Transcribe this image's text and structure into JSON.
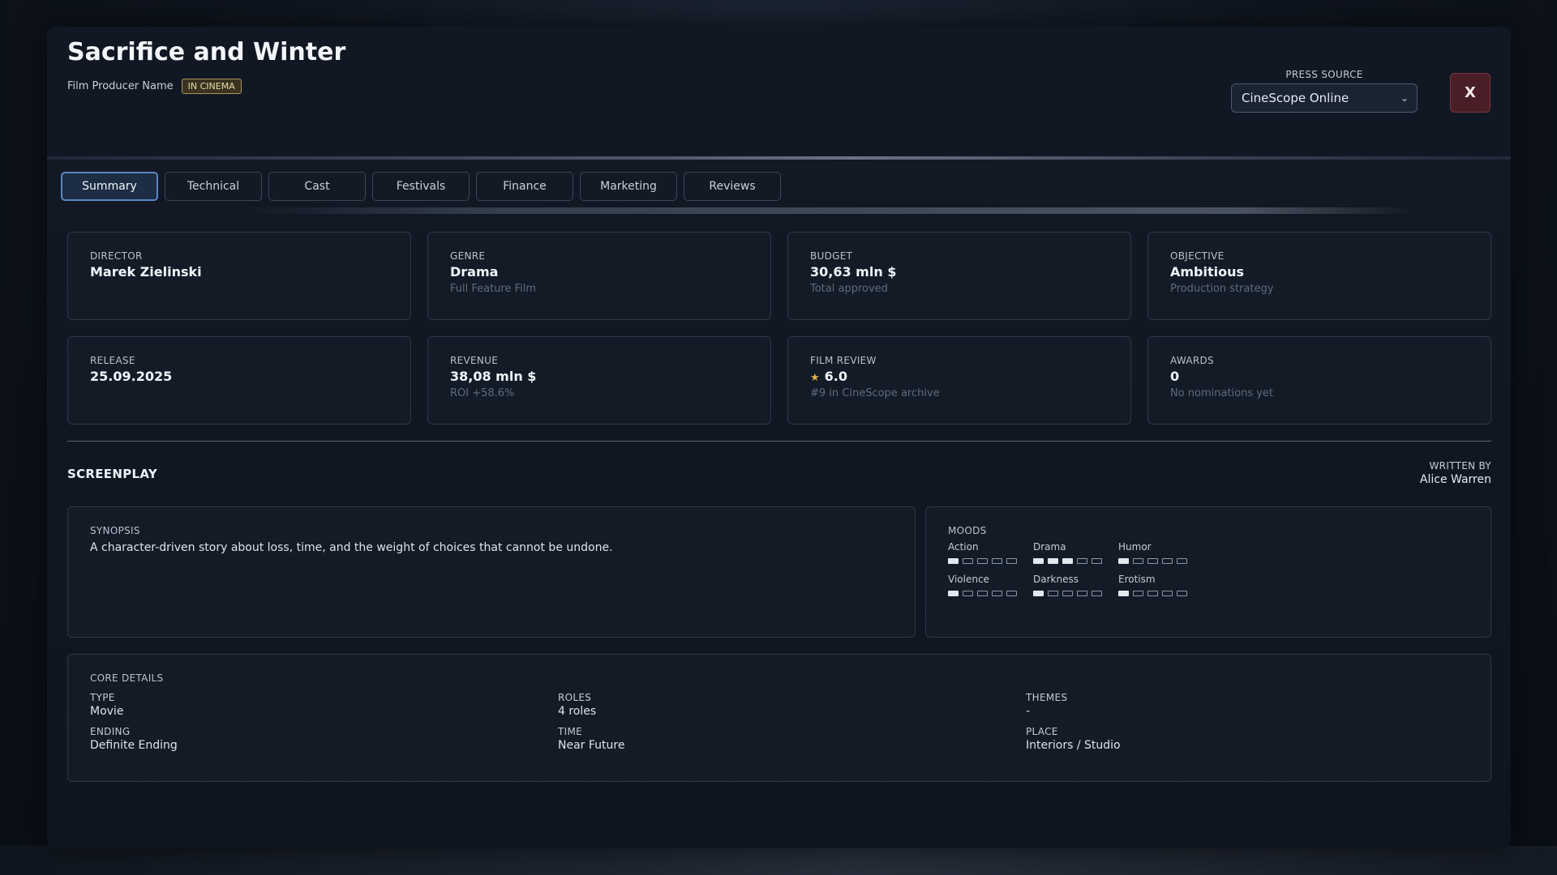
{
  "header": {
    "title": "Sacrifice and Winter",
    "producer": "Film Producer Name",
    "status_badge": "IN CINEMA",
    "press_source_label": "PRESS SOURCE",
    "press_source_value": "CineScope Online",
    "close_label": "X"
  },
  "tabs": [
    {
      "label": "Summary",
      "active": true
    },
    {
      "label": "Technical"
    },
    {
      "label": "Cast"
    },
    {
      "label": "Festivals"
    },
    {
      "label": "Finance"
    },
    {
      "label": "Marketing"
    },
    {
      "label": "Reviews"
    }
  ],
  "cards": [
    {
      "label": "DIRECTOR",
      "value": "Marek Zielinski",
      "sub": ""
    },
    {
      "label": "GENRE",
      "value": "Drama",
      "sub": "Full Feature Film"
    },
    {
      "label": "BUDGET",
      "value": "30,63 mln $",
      "sub": "Total approved"
    },
    {
      "label": "OBJECTIVE",
      "value": "Ambitious",
      "sub": "Production strategy"
    },
    {
      "label": "RELEASE",
      "value": "25.09.2025",
      "sub": ""
    },
    {
      "label": "REVENUE",
      "value": "38,08 mln $",
      "sub": "ROI +58.6%"
    },
    {
      "label": "FILM REVIEW",
      "value": "6.0",
      "sub": "#9 in CineScope archive"
    },
    {
      "label": "AWARDS",
      "value": "0",
      "sub": "No nominations yet"
    }
  ],
  "screenplay": {
    "title": "SCREENPLAY",
    "written_by_label": "WRITTEN BY",
    "written_by": "Alice Warren",
    "synopsis_label": "SYNOPSIS",
    "synopsis": "A character-driven story about loss, time, and the weight of choices that cannot be undone.",
    "moods_label": "MOODS",
    "moods": [
      {
        "name": "Action",
        "level": 1,
        "max": 5
      },
      {
        "name": "Drama",
        "level": 3,
        "max": 5
      },
      {
        "name": "Humor",
        "level": 1,
        "max": 5
      },
      {
        "name": "Violence",
        "level": 1,
        "max": 5
      },
      {
        "name": "Darkness",
        "level": 1,
        "max": 5
      },
      {
        "name": "Erotism",
        "level": 1,
        "max": 5
      }
    ]
  },
  "core": {
    "title": "CORE DETAILS",
    "type_label": "TYPE",
    "type": "Movie",
    "roles_label": "ROLES",
    "roles": "4 roles",
    "themes_label": "THEMES",
    "themes": "-",
    "ending_label": "ENDING",
    "ending": "Definite Ending",
    "time_label": "TIME",
    "time": "Near Future",
    "place_label": "PLACE",
    "place": "Interiors / Studio"
  },
  "icons": {
    "dropdown": "chevron-down-icon",
    "rating": "star-icon"
  }
}
